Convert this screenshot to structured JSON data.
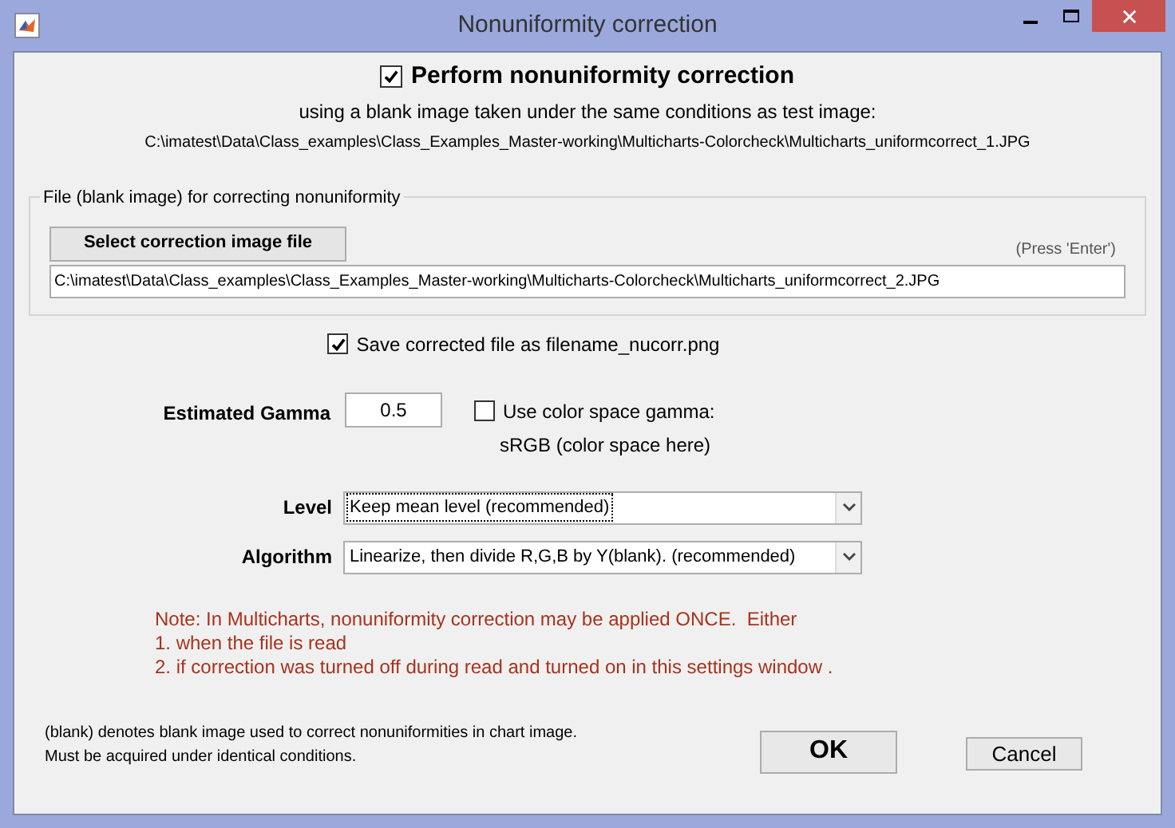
{
  "window": {
    "title": "Nonuniformity correction"
  },
  "header": {
    "checked": true,
    "label": "Perform nonuniformity correction",
    "subtitle": "using a blank image taken under the same conditions as test image:",
    "test_image_path": "C:\\imatest\\Data\\Class_examples\\Class_Examples_Master-working\\Multicharts-Colorcheck\\Multicharts_uniformcorrect_1.JPG"
  },
  "file_group": {
    "legend": "File (blank image) for correcting nonuniformity",
    "select_button": "Select correction image file",
    "hint": "(Press 'Enter')",
    "path_value": "C:\\imatest\\Data\\Class_examples\\Class_Examples_Master-working\\Multicharts-Colorcheck\\Multicharts_uniformcorrect_2.JPG"
  },
  "save_option": {
    "checked": true,
    "label": "Save corrected file as filename_nucorr.png"
  },
  "gamma": {
    "label": "Estimated Gamma",
    "value": "0.5"
  },
  "color_space": {
    "checked": false,
    "label": "Use color space gamma:",
    "note": "sRGB (color space here)"
  },
  "dropdowns": [
    {
      "label": "Level",
      "value": "Keep mean level (recommended)",
      "focused": true
    },
    {
      "label": "Algorithm",
      "value": "Linearize, then divide R,G,B by Y(blank). (recommended)",
      "focused": false
    }
  ],
  "note_lines": [
    "Note: In Multicharts, nonuniformity correction may be applied ONCE.  Either",
    "1. when the file is read",
    "2. if correction was turned off during read and turned on in this settings window ."
  ],
  "footnote_lines": [
    "(blank) denotes blank image used to correct nonuniformities in chart image.",
    "Must be acquired under identical conditions."
  ],
  "buttons": [
    "OK",
    "Cancel"
  ]
}
